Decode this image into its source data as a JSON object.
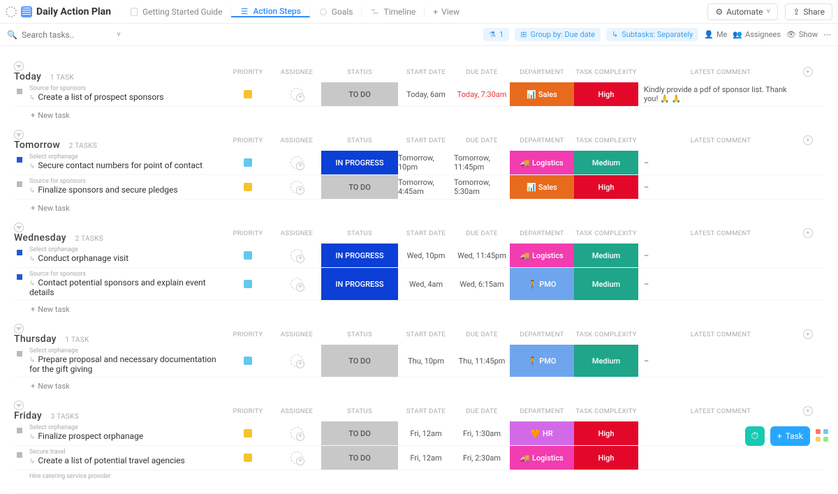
{
  "title": "Daily Action Plan",
  "views": {
    "guide": "Getting Started Guide",
    "steps": "Action Steps",
    "goals": "Goals",
    "timeline": "Timeline",
    "add": "View"
  },
  "toolbar": {
    "automate": "Automate",
    "share": "Share"
  },
  "filterbar": {
    "search_ph": "Search tasks..",
    "filter_count": "1",
    "group_by": "Group by: Due date",
    "subtasks": "Subtasks: Separately",
    "me": "Me",
    "assignees": "Assignees",
    "show": "Show"
  },
  "columns": {
    "priority": "PRIORITY",
    "assignee": "ASSIGNEE",
    "status": "STATUS",
    "start": "START DATE",
    "due": "DUE DATE",
    "dept": "DEPARTMENT",
    "cx": "TASK COMPLEXITY",
    "comment": "LATEST COMMENT"
  },
  "labels": {
    "new_task": "New task",
    "task_btn": "Task"
  },
  "dept_labels": {
    "sales": "Sales",
    "log": "Logistics",
    "pmo": "PMO",
    "hr": "HR"
  },
  "dept_emoji": {
    "sales": "📊",
    "log": "🚚",
    "pmo": "🧍",
    "hr": "🧡"
  },
  "cx_labels": {
    "high": "High",
    "med": "Medium"
  },
  "status_labels": {
    "todo": "TO DO",
    "prog": "IN PROGRESS"
  },
  "groups": [
    {
      "day": "Today",
      "count": "1 TASK",
      "tasks": [
        {
          "src": "Source for sponsors",
          "name": "Create a list of prospect sponsors",
          "flag": "y",
          "status": "todo",
          "start": "Today, 6am",
          "due": "Today, 7:30am",
          "due_red": true,
          "dept": "sales",
          "cx": "high",
          "comment": "Kindly provide a pdf of sponsor list. Thank you! 🙏 🙏",
          "sq": "grey"
        }
      ]
    },
    {
      "day": "Tomorrow",
      "count": "2 TASKS",
      "tasks": [
        {
          "src": "Select orphanage",
          "name": "Secure contact numbers for point of contact",
          "flag": "b",
          "status": "prog",
          "start": "Tomorrow, 10pm",
          "due": "Tomorrow, 11:45pm",
          "dept": "log",
          "cx": "med",
          "comment": "–",
          "sq": "blue"
        },
        {
          "src": "Source for sponsors",
          "name": "Finalize sponsors and secure pledges",
          "flag": "y",
          "status": "todo",
          "start": "Tomorrow, 4:45am",
          "due": "Tomorrow, 5:30am",
          "dept": "sales",
          "cx": "high",
          "comment": "–",
          "sq": "grey"
        }
      ]
    },
    {
      "day": "Wednesday",
      "count": "2 TASKS",
      "tasks": [
        {
          "src": "Select orphanage",
          "name": "Conduct orphanage visit",
          "flag": "b",
          "status": "prog",
          "start": "Wed, 10pm",
          "due": "Wed, 11:45pm",
          "dept": "log",
          "cx": "med",
          "comment": "–",
          "sq": "blue"
        },
        {
          "src": "Source for sponsors",
          "name": "Contact potential sponsors and explain event details",
          "flag": "b",
          "status": "prog",
          "start": "Wed, 4am",
          "due": "Wed, 6:15am",
          "dept": "pmo",
          "cx": "med",
          "comment": "–",
          "sq": "blue"
        }
      ]
    },
    {
      "day": "Thursday",
      "count": "1 TASK",
      "tasks": [
        {
          "src": "Select orphanage",
          "name": "Prepare proposal and necessary documentation for the gift giving",
          "flag": "b",
          "status": "todo",
          "start": "Thu, 10pm",
          "due": "Thu, 11:45pm",
          "dept": "pmo",
          "cx": "med",
          "comment": "–",
          "sq": "grey"
        }
      ]
    },
    {
      "day": "Friday",
      "count": "3 TASKS",
      "tasks": [
        {
          "src": "Select orphanage",
          "name": "Finalize prospect orphanage",
          "flag": "y",
          "status": "todo",
          "start": "Fri, 12am",
          "due": "Fri, 1:30am",
          "dept": "hr",
          "cx": "high",
          "comment": "",
          "sq": "grey"
        },
        {
          "src": "Secure travel",
          "name": "Create a list of potential travel agencies",
          "flag": "y",
          "status": "todo",
          "start": "Fri, 12am",
          "due": "Fri, 2:30am",
          "dept": "log",
          "cx": "high",
          "comment": "",
          "sq": "grey"
        },
        {
          "src": "Hire catering service provider",
          "name": "",
          "flag": "",
          "status": "",
          "start": "",
          "due": "",
          "dept": "",
          "cx": "",
          "comment": "",
          "sq": ""
        }
      ]
    }
  ]
}
